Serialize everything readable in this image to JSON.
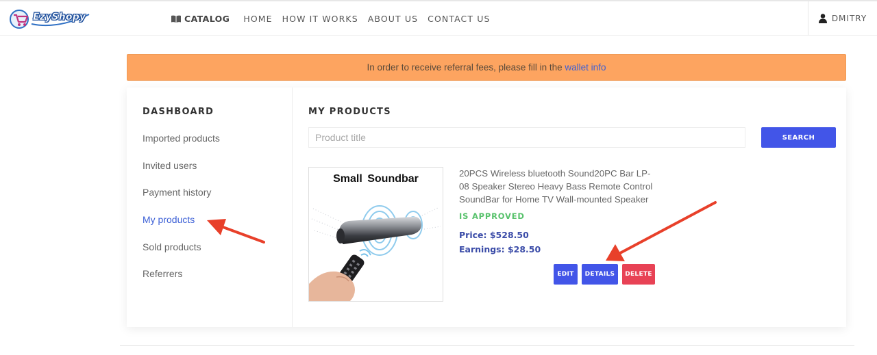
{
  "brand": {
    "name": "EzyShopy"
  },
  "nav": {
    "catalog": "CATALOG",
    "home": "HOME",
    "how_it_works": "HOW IT WORKS",
    "about_us": "ABOUT US",
    "contact_us": "CONTACT US",
    "user": "DMITRY"
  },
  "alert": {
    "text": "In order to receive referral fees, please fill in the ",
    "link": "wallet info"
  },
  "sidebar": {
    "title": "DASHBOARD",
    "items": [
      {
        "label": "Imported products"
      },
      {
        "label": "Invited users"
      },
      {
        "label": "Payment history"
      },
      {
        "label": "My products",
        "active": true
      },
      {
        "label": "Sold products"
      },
      {
        "label": "Referrers"
      }
    ]
  },
  "main": {
    "title": "MY PRODUCTS",
    "search": {
      "placeholder": "Product title",
      "button": "SEARCH"
    },
    "product": {
      "image_caption": "Small  Soundbar",
      "name": "20PCS Wireless bluetooth Sound20PC Bar LP-08 Speaker Stereo Heavy Bass Remote Control SoundBar for Home TV Wall-mounted Speaker",
      "status": "IS APPROVED",
      "price": "Price: $528.50",
      "earnings": "Earnings: $28.50",
      "actions": {
        "edit": "EDIT",
        "details": "DETAILS",
        "delete": "DELETE"
      }
    }
  },
  "colors": {
    "accent": "#4255e8",
    "danger": "#e84255",
    "alert_bg": "#fda460",
    "approved": "#58c26c",
    "link": "#3b5fd6",
    "annotation_arrow": "#e8402a"
  }
}
